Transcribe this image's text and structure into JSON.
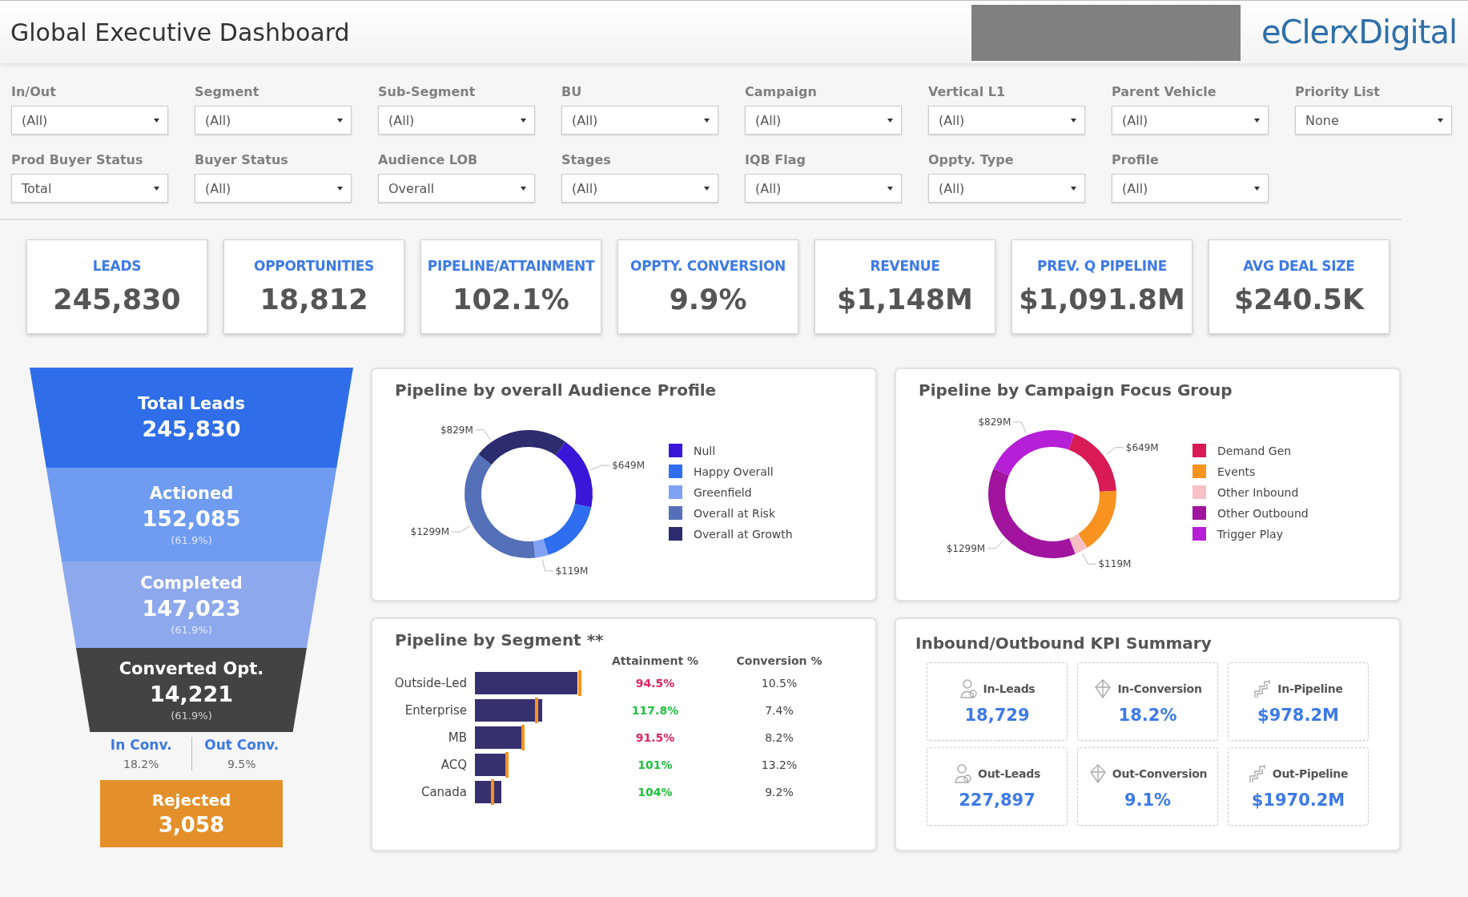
{
  "header": {
    "title": "Global Executive Dashboard",
    "logo": "eClerxDigital"
  },
  "filters": [
    {
      "label": "In/Out",
      "value": "(All)"
    },
    {
      "label": "Segment",
      "value": "(All)"
    },
    {
      "label": "Sub-Segment",
      "value": "(All)"
    },
    {
      "label": "BU",
      "value": "(All)"
    },
    {
      "label": "Campaign",
      "value": "(All)"
    },
    {
      "label": "Vertical L1",
      "value": "(All)"
    },
    {
      "label": "Parent Vehicle",
      "value": "(All)"
    },
    {
      "label": "Priority List",
      "value": "None"
    },
    {
      "label": "Prod Buyer Status",
      "value": "Total"
    },
    {
      "label": "Buyer Status",
      "value": "(All)"
    },
    {
      "label": "Audience LOB",
      "value": "Overall"
    },
    {
      "label": "Stages",
      "value": "(All)"
    },
    {
      "label": "IQB Flag",
      "value": "(All)"
    },
    {
      "label": "Oppty. Type",
      "value": "(All)"
    },
    {
      "label": "Profile",
      "value": "(All)"
    }
  ],
  "kpis": [
    {
      "label": "LEADS",
      "value": "245,830"
    },
    {
      "label": "OPPORTUNITIES",
      "value": "18,812"
    },
    {
      "label": "PIPELINE/ATTAINMENT",
      "value": "102.1%"
    },
    {
      "label": "OPPTY. CONVERSION",
      "value": "9.9%"
    },
    {
      "label": "REVENUE",
      "value": "$1,148M"
    },
    {
      "label": "PREV. Q PIPELINE",
      "value": "$1,091.8M"
    },
    {
      "label": "AVG DEAL SIZE",
      "value": "$240.5K"
    }
  ],
  "funnel": {
    "stages": [
      {
        "label": "Total Leads",
        "value": "245,830",
        "color": "#2f6ee8"
      },
      {
        "label": "Actioned",
        "value": "152,085",
        "percent": "(61.9%)",
        "color": "#6f9cf1"
      },
      {
        "label": "Completed",
        "value": "147,023",
        "percent": "(61.9%)",
        "color": "#8da8ec"
      },
      {
        "label": "Converted Opt.",
        "value": "14,221",
        "percent": "(61.9%)",
        "color": "#434343"
      }
    ],
    "split": [
      {
        "label": "In Conv.",
        "value": "18.2%"
      },
      {
        "label": "Out Conv.",
        "value": "9.5%"
      }
    ],
    "rejected": {
      "label": "Rejected",
      "value": "3,058"
    }
  },
  "donuts": [
    {
      "title": "Pipeline by overall Audience Profile",
      "slices": [
        {
          "name": "Null",
          "color": "#3a16d8",
          "label": "$649M"
        },
        {
          "name": "Happy Overall",
          "color": "#2f6ef0"
        },
        {
          "name": "Greenfield",
          "color": "#7fa2f5",
          "label": "$119M"
        },
        {
          "name": "Overall at Risk",
          "color": "#5470b8",
          "label": "$1299M"
        },
        {
          "name": "Overall at Growth",
          "color": "#2b2d6e",
          "label": "$829M"
        }
      ]
    },
    {
      "title": "Pipeline by Campaign Focus Group",
      "slices": [
        {
          "name": "Demand Gen",
          "color": "#d81b55",
          "label": "$649M"
        },
        {
          "name": "Events",
          "color": "#f7931e"
        },
        {
          "name": "Other Inbound",
          "color": "#f7c0c4",
          "label": "$119M"
        },
        {
          "name": "Other Outbound",
          "color": "#a0149e",
          "label": "$1299M"
        },
        {
          "name": "Trigger Play",
          "color": "#b51fd6",
          "label": "$829M"
        }
      ]
    }
  ],
  "segments": {
    "title": "Pipeline by Segment **",
    "columns": [
      "Attainment %",
      "Conversion %"
    ],
    "rows": [
      {
        "name": "Outside-Led",
        "attainment": "94.5%",
        "met": false,
        "conversion": "10.5%"
      },
      {
        "name": "Enterprise",
        "attainment": "117.8%",
        "met": true,
        "conversion": "7.4%"
      },
      {
        "name": "MB",
        "attainment": "91.5%",
        "met": false,
        "conversion": "8.2%"
      },
      {
        "name": "ACQ",
        "attainment": "101%",
        "met": true,
        "conversion": "13.2%"
      },
      {
        "name": "Canada",
        "attainment": "104%",
        "met": true,
        "conversion": "9.2%"
      }
    ]
  },
  "kpi_summary": {
    "title": "Inbound/Outbound KPI Summary",
    "tiles": [
      {
        "kind": "leads",
        "label": "In-Leads",
        "value": "18,729"
      },
      {
        "kind": "conversion",
        "label": "In-Conversion",
        "value": "18.2%"
      },
      {
        "kind": "pipeline",
        "label": "In-Pipeline",
        "value": "$978.2M"
      },
      {
        "kind": "leads",
        "label": "Out-Leads",
        "value": "227,897"
      },
      {
        "kind": "conversion",
        "label": "Out-Conversion",
        "value": "9.1%"
      },
      {
        "kind": "pipeline",
        "label": "Out-Pipeline",
        "value": "$1970.2M"
      }
    ]
  }
}
